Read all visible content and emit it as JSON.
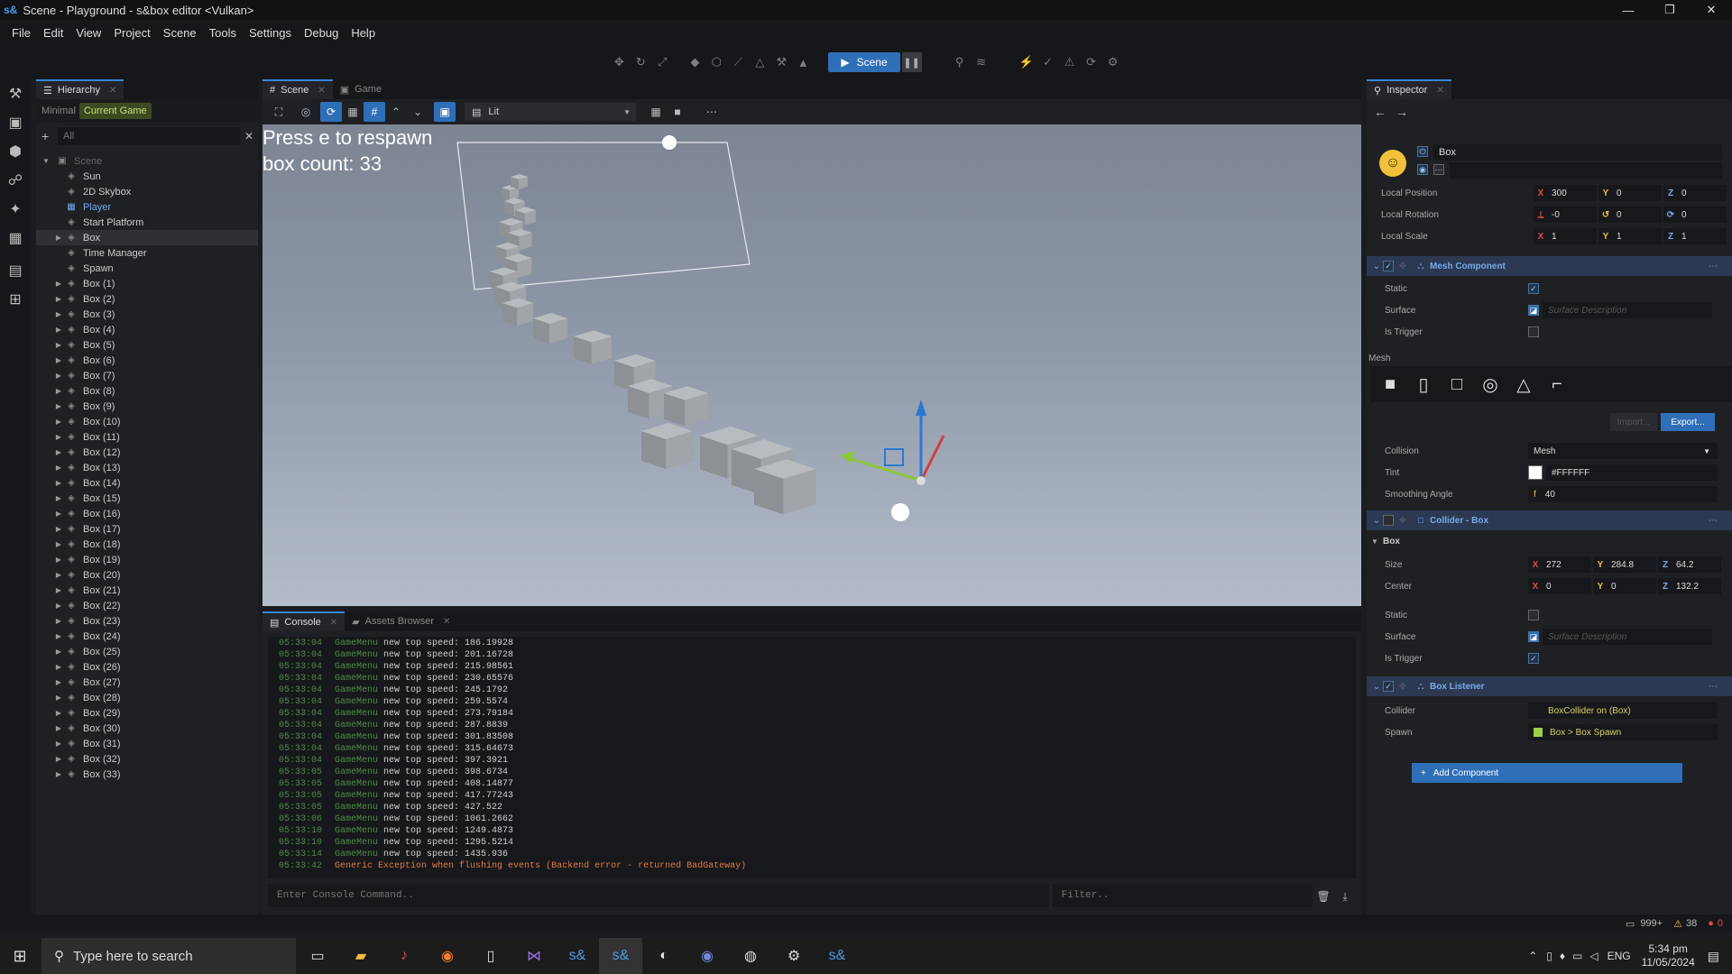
{
  "window": {
    "logo": "s&",
    "title": "Scene - Playground - s&box editor <Vulkan>",
    "min": "—",
    "max": "❐",
    "close": "✕"
  },
  "menu": [
    "File",
    "Edit",
    "View",
    "Project",
    "Scene",
    "Tools",
    "Settings",
    "Debug",
    "Help"
  ],
  "toolbar": {
    "play_label": "Scene",
    "pause": "❚❚"
  },
  "hierarchy": {
    "tab": "Hierarchy",
    "mode_minimal": "Minimal",
    "mode_current": "Current Game",
    "search_placeholder": "All",
    "root": "Scene",
    "items": [
      "Sun",
      "2D Skybox",
      "Player",
      "Start Platform",
      "Box",
      "Time Manager",
      "Spawn",
      "Box (1)",
      "Box (2)",
      "Box (3)",
      "Box (4)",
      "Box (5)",
      "Box (6)",
      "Box (7)",
      "Box (8)",
      "Box (9)",
      "Box (10)",
      "Box (11)",
      "Box (12)",
      "Box (13)",
      "Box (14)",
      "Box (15)",
      "Box (16)",
      "Box (17)",
      "Box (18)",
      "Box (19)",
      "Box (20)",
      "Box (21)",
      "Box (22)",
      "Box (23)",
      "Box (24)",
      "Box (25)",
      "Box (26)",
      "Box (27)",
      "Box (28)",
      "Box (29)",
      "Box (30)",
      "Box (31)",
      "Box (32)",
      "Box (33)"
    ]
  },
  "scene": {
    "tabs": [
      "Scene",
      "Game"
    ],
    "render_mode": "Lit",
    "hud_line1": "Press e to respawn",
    "hud_line2": "box count: 33"
  },
  "console": {
    "tabs": [
      "Console",
      "Assets Browser"
    ],
    "lines": [
      {
        "t": "05:33:04",
        "src": "GameMenu",
        "msg": "new top speed: 186.19928"
      },
      {
        "t": "05:33:04",
        "src": "GameMenu",
        "msg": "new top speed: 201.16728"
      },
      {
        "t": "05:33:04",
        "src": "GameMenu",
        "msg": "new top speed: 215.98561"
      },
      {
        "t": "05:33:04",
        "src": "GameMenu",
        "msg": "new top speed: 230.65576"
      },
      {
        "t": "05:33:04",
        "src": "GameMenu",
        "msg": "new top speed: 245.1792"
      },
      {
        "t": "05:33:04",
        "src": "GameMenu",
        "msg": "new top speed: 259.5574"
      },
      {
        "t": "05:33:04",
        "src": "GameMenu",
        "msg": "new top speed: 273.79184"
      },
      {
        "t": "05:33:04",
        "src": "GameMenu",
        "msg": "new top speed: 287.8839"
      },
      {
        "t": "05:33:04",
        "src": "GameMenu",
        "msg": "new top speed: 301.83508"
      },
      {
        "t": "05:33:04",
        "src": "GameMenu",
        "msg": "new top speed: 315.64673"
      },
      {
        "t": "05:33:04",
        "src": "GameMenu",
        "msg": "new top speed: 397.3921"
      },
      {
        "t": "05:33:05",
        "src": "GameMenu",
        "msg": "new top speed: 398.6734"
      },
      {
        "t": "05:33:05",
        "src": "GameMenu",
        "msg": "new top speed: 408.14877"
      },
      {
        "t": "05:33:05",
        "src": "GameMenu",
        "msg": "new top speed: 417.77243"
      },
      {
        "t": "05:33:05",
        "src": "GameMenu",
        "msg": "new top speed: 427.522"
      },
      {
        "t": "05:33:06",
        "src": "GameMenu",
        "msg": "new top speed: 1061.2662"
      },
      {
        "t": "05:33:10",
        "src": "GameMenu",
        "msg": "new top speed: 1249.4873"
      },
      {
        "t": "05:33:10",
        "src": "GameMenu",
        "msg": "new top speed: 1295.5214"
      },
      {
        "t": "05:33:14",
        "src": "GameMenu",
        "msg": "new top speed: 1435.936"
      },
      {
        "t": "05:33:42",
        "src": "Generic",
        "msg": "Exception when flushing events (Backend error - returned BadGateway)",
        "err": true
      }
    ],
    "cmd_placeholder": "Enter Console Command..",
    "filter_placeholder": "Filter.."
  },
  "inspector": {
    "tab": "Inspector",
    "name": "Box",
    "local_position": {
      "label": "Local Position",
      "x": "300",
      "y": "0",
      "z": "0"
    },
    "local_rotation": {
      "label": "Local Rotation",
      "x": "-0",
      "y": "0",
      "z": "0"
    },
    "local_scale": {
      "label": "Local Scale",
      "x": "1",
      "y": "1",
      "z": "1"
    },
    "mesh_component": {
      "title": "Mesh Component",
      "static": "Static",
      "surface": "Surface",
      "surface_placeholder": "Surface Description",
      "is_trigger": "Is Trigger",
      "mesh": "Mesh",
      "import": "Import...",
      "export": "Export...",
      "collision": "Collision",
      "collision_value": "Mesh",
      "tint": "Tint",
      "tint_value": "#FFFFFF",
      "tint_color": "#ffffff",
      "smoothing": "Smoothing Angle",
      "smoothing_prefix": "f",
      "smoothing_value": "40"
    },
    "collider_box": {
      "title": "Collider - Box",
      "group": "Box",
      "size": {
        "label": "Size",
        "x": "272",
        "y": "284.8",
        "z": "64.2"
      },
      "center": {
        "label": "Center",
        "x": "0",
        "y": "0",
        "z": "132.2"
      },
      "static": "Static",
      "surface": "Surface",
      "surface_placeholder": "Surface Description",
      "is_trigger": "Is Trigger"
    },
    "box_listener": {
      "title": "Box Listener",
      "collider": "Collider",
      "collider_value": "BoxCollider on (Box)",
      "spawn": "Spawn",
      "spawn_value": "Box > Box Spawn"
    },
    "add_component": "Add Component"
  },
  "status": {
    "messages": "999+",
    "warnings": "38",
    "errors": "0"
  },
  "taskbar": {
    "search": "Type here to search",
    "lang": "ENG",
    "time": "5:34 pm",
    "date": "11/05/2024"
  }
}
